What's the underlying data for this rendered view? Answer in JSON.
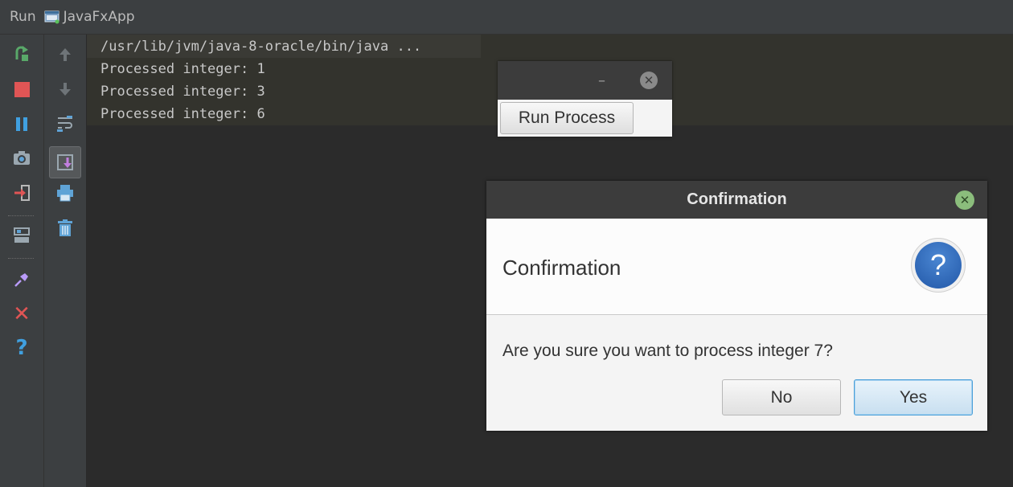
{
  "toolwindow": {
    "run_label": "Run",
    "app_label": "JavaFxApp"
  },
  "toolbar_left": [
    "rerun-icon",
    "stop-icon",
    "pause-icon",
    "camera-icon",
    "exit-icon",
    "layout-icon",
    "pin-icon",
    "close-icon",
    "help-icon"
  ],
  "toolbar_right": [
    "up-arrow-icon",
    "down-arrow-icon",
    "soft-wrap-icon",
    "scroll-to-end-icon",
    "print-icon",
    "trash-icon"
  ],
  "console": {
    "lines": [
      "/usr/lib/jvm/java-8-oracle/bin/java ...",
      "Processed integer: 1",
      "Processed integer: 3",
      "Processed integer: 6"
    ]
  },
  "fx_window": {
    "minimize": "–",
    "run_button": "Run Process"
  },
  "dialog": {
    "title": "Confirmation",
    "header": "Confirmation",
    "icon_symbol": "?",
    "content": "Are you sure you want to process integer 7?",
    "no_label": "No",
    "yes_label": "Yes"
  },
  "colors": {
    "ide_bg": "#2b2b2b",
    "panel_bg": "#3c3f41",
    "stop_red": "#e05555",
    "rerun_green": "#59a869",
    "pause_blue": "#40a0e0",
    "dialog_accent": "#4a9fd8"
  }
}
